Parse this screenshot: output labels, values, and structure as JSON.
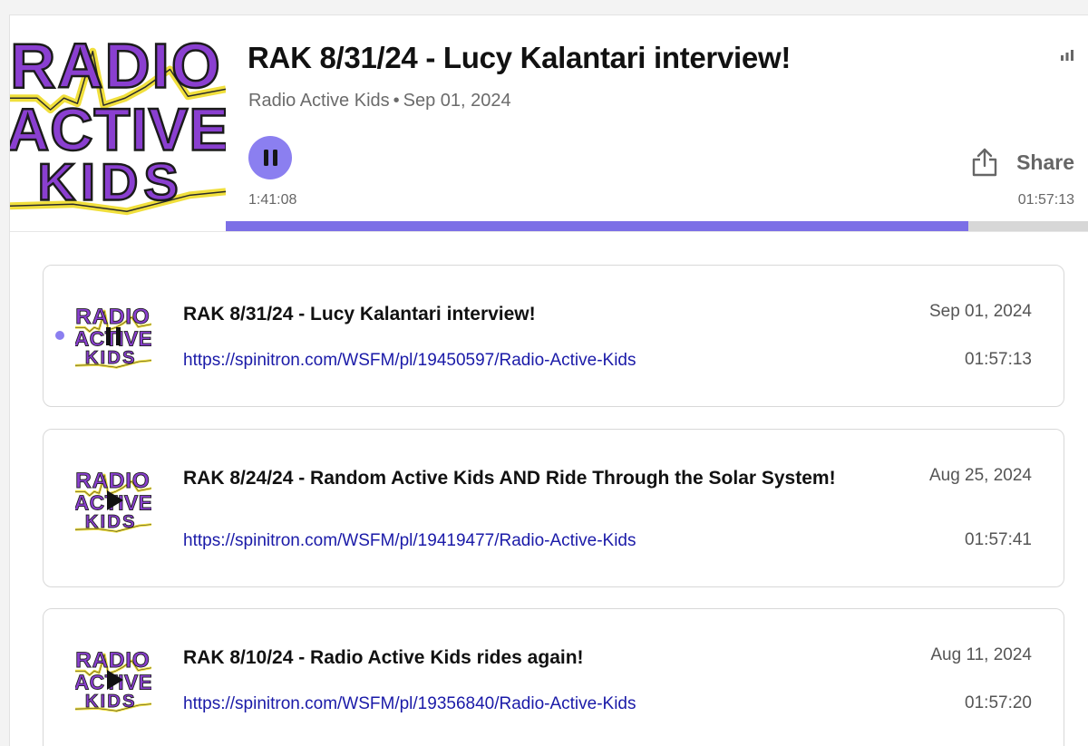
{
  "player": {
    "cover_logo_text": "RADIO ACTIVE KIDS",
    "title": "RAK 8/31/24 - Lucy Kalantari interview!",
    "show": "Radio Active Kids",
    "separator": "•",
    "date": "Sep 01, 2024",
    "current_time": "1:41:08",
    "total_time": "01:57:13",
    "progress_fraction": 0.8607,
    "share_label": "Share",
    "icons": {
      "play_state": "pause-icon",
      "share": "share-icon",
      "stats": "signal-bars-icon"
    }
  },
  "episodes": [
    {
      "title": "RAK 8/31/24 - Lucy Kalantari interview!",
      "link": "https://spinitron.com/WSFM/pl/19450597/Radio-Active-Kids",
      "date": "Sep 01, 2024",
      "duration": "01:57:13",
      "state": "playing"
    },
    {
      "title": "RAK 8/24/24 - Random Active Kids AND Ride Through the Solar System!",
      "link": "https://spinitron.com/WSFM/pl/19419477/Radio-Active-Kids",
      "date": "Aug 25, 2024",
      "duration": "01:57:41",
      "state": "paused"
    },
    {
      "title": "RAK 8/10/24 - Radio Active Kids rides again!",
      "link": "https://spinitron.com/WSFM/pl/19356840/Radio-Active-Kids",
      "date": "Aug 11, 2024",
      "duration": "01:57:20",
      "state": "paused"
    }
  ],
  "colors": {
    "accent": "#8b7ff0",
    "progress_fill": "#7c6fe6",
    "progress_track": "#d7d7d7",
    "link": "#1a1aa8",
    "logo_purple": "#8a3fd0",
    "logo_yellow": "#f0df3c"
  }
}
